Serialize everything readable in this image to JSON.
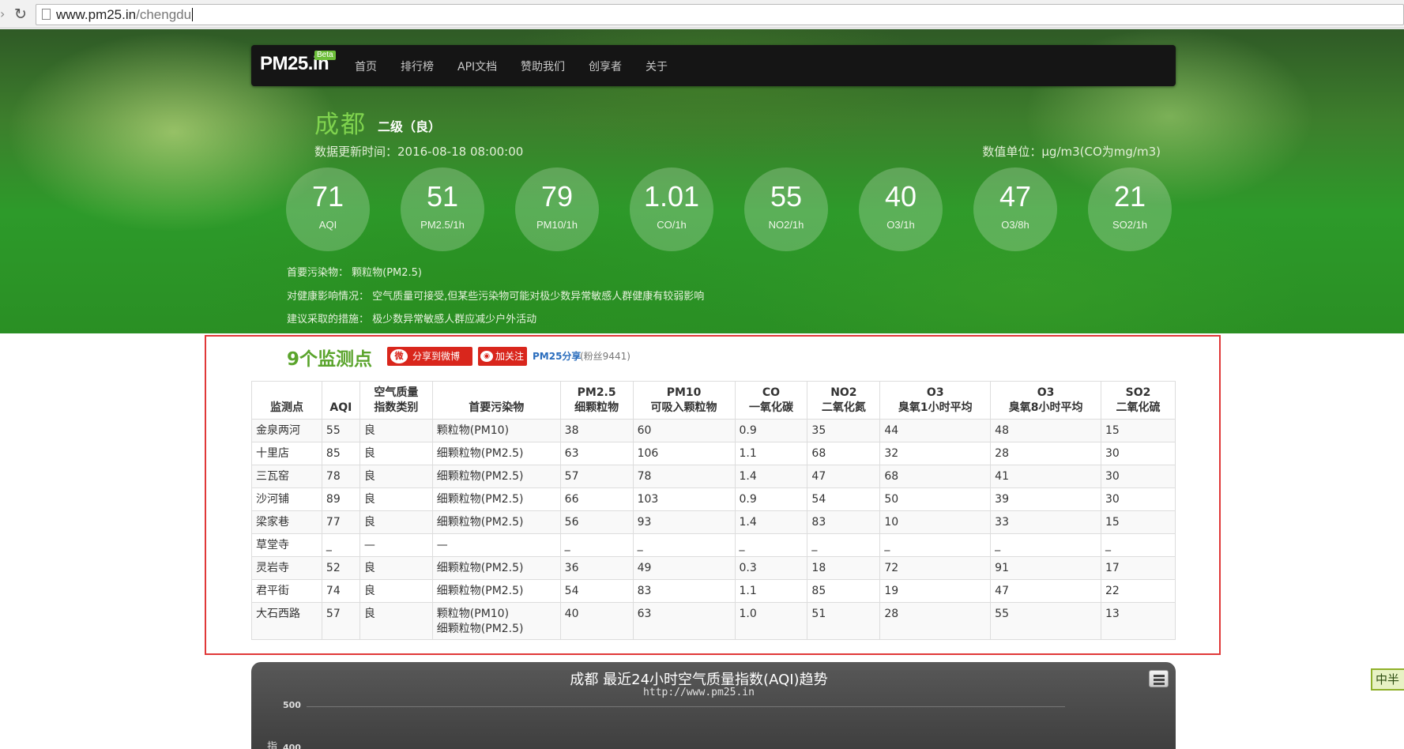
{
  "browser": {
    "url_host": "www.pm25.in",
    "url_path": "/chengdu"
  },
  "nav": {
    "logo": "PM25.in",
    "beta": "Beta",
    "items": [
      "首页",
      "排行榜",
      "API文档",
      "赞助我们",
      "创享者",
      "关于"
    ]
  },
  "city": {
    "name": "成都",
    "grade": "二级（良）",
    "update_time": "数据更新时间：2016-08-18 08:00:00",
    "unit": "数值单位：μg/m3(CO为mg/m3)"
  },
  "metrics": [
    {
      "value": "71",
      "label": "AQI"
    },
    {
      "value": "51",
      "label": "PM2.5/1h"
    },
    {
      "value": "79",
      "label": "PM10/1h"
    },
    {
      "value": "1.01",
      "label": "CO/1h"
    },
    {
      "value": "55",
      "label": "NO2/1h"
    },
    {
      "value": "40",
      "label": "O3/1h"
    },
    {
      "value": "47",
      "label": "O3/8h"
    },
    {
      "value": "21",
      "label": "SO2/1h"
    }
  ],
  "info": {
    "primary_pollutant": "首要污染物：  颗粒物(PM2.5)",
    "health_effect": "对健康影响情况：  空气质量可接受,但某些污染物可能对极少数异常敏感人群健康有较弱影响",
    "advice": "建议采取的措施：  极少数异常敏感人群应减少户外活动"
  },
  "stations": {
    "title": "9个监测点",
    "share_label": "分享到微博",
    "follow_label": "加关注",
    "weibo_account": "PM25分享",
    "fans": "(粉丝9441)",
    "headers": [
      [
        "",
        "监测点"
      ],
      [
        "",
        "AQI"
      ],
      [
        "空气质量",
        "指数类别"
      ],
      [
        "",
        "首要污染物"
      ],
      [
        "PM2.5",
        "细颗粒物"
      ],
      [
        "PM10",
        "可吸入颗粒物"
      ],
      [
        "CO",
        "一氧化碳"
      ],
      [
        "NO2",
        "二氧化氮"
      ],
      [
        "O3",
        "臭氧1小时平均"
      ],
      [
        "O3",
        "臭氧8小时平均"
      ],
      [
        "SO2",
        "二氧化硫"
      ]
    ],
    "rows": [
      [
        "金泉两河",
        "55",
        "良",
        "颗粒物(PM10)",
        "38",
        "60",
        "0.9",
        "35",
        "44",
        "48",
        "15"
      ],
      [
        "十里店",
        "85",
        "良",
        "细颗粒物(PM2.5)",
        "63",
        "106",
        "1.1",
        "68",
        "32",
        "28",
        "30"
      ],
      [
        "三瓦窑",
        "78",
        "良",
        "细颗粒物(PM2.5)",
        "57",
        "78",
        "1.4",
        "47",
        "68",
        "41",
        "30"
      ],
      [
        "沙河铺",
        "89",
        "良",
        "细颗粒物(PM2.5)",
        "66",
        "103",
        "0.9",
        "54",
        "50",
        "39",
        "30"
      ],
      [
        "梁家巷",
        "77",
        "良",
        "细颗粒物(PM2.5)",
        "56",
        "93",
        "1.4",
        "83",
        "10",
        "33",
        "15"
      ],
      [
        "草堂寺",
        "_",
        "—",
        "—",
        "_",
        "_",
        "_",
        "_",
        "_",
        "_",
        "_"
      ],
      [
        "灵岩寺",
        "52",
        "良",
        "细颗粒物(PM2.5)",
        "36",
        "49",
        "0.3",
        "18",
        "72",
        "91",
        "17"
      ],
      [
        "君平街",
        "74",
        "良",
        "细颗粒物(PM2.5)",
        "54",
        "83",
        "1.1",
        "85",
        "19",
        "47",
        "22"
      ],
      [
        "大石西路",
        "57",
        "良",
        "颗粒物(PM10)\n细颗粒物(PM2.5)",
        "40",
        "63",
        "1.0",
        "51",
        "28",
        "55",
        "13"
      ]
    ]
  },
  "chart": {
    "title": "成都 最近24小时空气质量指数(AQI)趋势",
    "subtitle": "http://www.pm25.in",
    "y_axis_label": "指",
    "tick_500": "500",
    "tick_400": "400"
  },
  "side_widget": "中半"
}
